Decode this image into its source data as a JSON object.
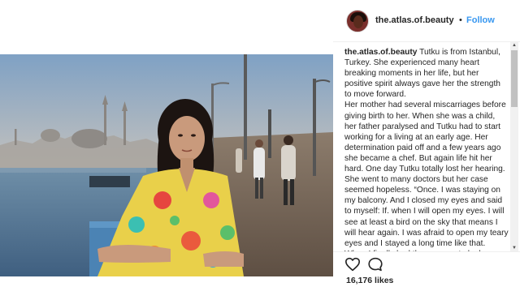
{
  "post": {
    "handle": "the.atlas.of.beauty",
    "separator": "•",
    "follow_label": "Follow",
    "likes": "16,176 likes"
  },
  "caption": {
    "user": "the.atlas.of.beauty",
    "p1": "Tutku is from Istanbul, Turkey. She experienced many heart breaking moments in her life, but her positive spirit always gave her the strength to move forward.",
    "p2": "Her mother had several miscarriages before giving birth to her. When she was a child, her father paralysed and Tutku had to start working for a living at an early age. Her determination paid off and a few years ago she became a chef. But again life hit her hard. One day Tutku totally lost her hearing. She went to many doctors but her case seemed hopeless. “Once. I was staying on my balcony. And I closed my eyes and said to myself: If. when I will open my eyes. I will see at least a bird on the sky that means I will hear again. I was afraid to open my teary eyes and I stayed a long time like that. When I finally had the courage to look"
  },
  "icons": {
    "heart": "heart-icon",
    "comment": "comment-icon",
    "scroll_up": "▲",
    "scroll_down": "▼"
  }
}
